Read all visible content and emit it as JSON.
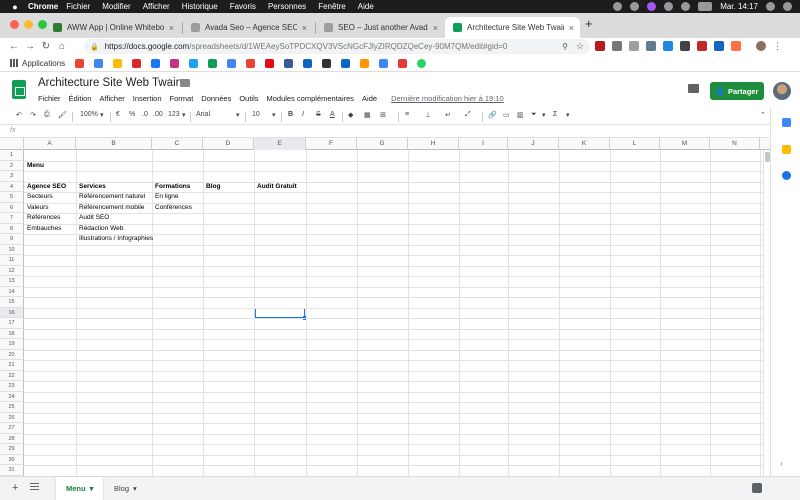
{
  "menubar": {
    "app": "Chrome",
    "items": [
      "Fichier",
      "Modifier",
      "Afficher",
      "Historique",
      "Favoris",
      "Personnes",
      "Fenêtre",
      "Aide"
    ],
    "clock": "Mar. 14:17"
  },
  "tabs": [
    {
      "title": "AWW App | Online Whiteboard",
      "color": "#2e7d32",
      "active": false
    },
    {
      "title": "Avada Seo – Agence SEO",
      "color": "#9e9e9e",
      "active": false
    },
    {
      "title": "SEO – Just another Avada Live",
      "color": "#9e9e9e",
      "active": false
    },
    {
      "title": "Architecture Site Web Twaino",
      "color": "#0f9d58",
      "active": true
    }
  ],
  "address": {
    "host": "https://docs.google.com",
    "path": "/spreadsheets/d/1WEAeySoTPDCXQV3VScNGcFJlyZIRQDZQeCey-90M7QM/edit#gid=0"
  },
  "bookmarks": {
    "apps_label": "Applications",
    "colors": [
      "#ea4335",
      "#4285f4",
      "#fbbc05",
      "#dc2626",
      "#1877f2",
      "#c13584",
      "#1da1f2",
      "#0f9d58",
      "#4285f4",
      "#ea4335",
      "#e50914",
      "#3b5998",
      "#0a66c2",
      "#333333",
      "#0a66c2",
      "#ff9800",
      "#4285f4",
      "#e53935",
      "#25d366"
    ]
  },
  "doc": {
    "title": "Architecture Site Web Twaino",
    "menu": [
      "Fichier",
      "Édition",
      "Afficher",
      "Insertion",
      "Format",
      "Données",
      "Outils",
      "Modules complémentaires",
      "Aide"
    ],
    "last_modified": "Dernière modification hier à 19:10",
    "share_label": "Partager"
  },
  "toolbar": {
    "zoom": "100%",
    "currency": "€",
    "percent": "%",
    "dec_less": ".0",
    "dec_more": ".00",
    "number_format": "123",
    "font": "Arial",
    "font_size": "10",
    "bold": "B",
    "italic": "I",
    "strike": "S",
    "text_color": "A"
  },
  "formula_bar": {
    "fx": "fx",
    "value": ""
  },
  "grid": {
    "columns": [
      "A",
      "B",
      "C",
      "D",
      "E",
      "F",
      "G",
      "H",
      "I",
      "J",
      "K",
      "L",
      "M",
      "N"
    ],
    "rows": [
      "1",
      "2",
      "3",
      "4",
      "5",
      "6",
      "7",
      "8",
      "9",
      "10",
      "11",
      "12",
      "13",
      "14",
      "15",
      "16",
      "17",
      "18",
      "19",
      "20",
      "21",
      "22",
      "23",
      "24",
      "25",
      "26",
      "27",
      "28",
      "29",
      "30",
      "31"
    ],
    "selected_column": "E",
    "selected_row": "16",
    "cells": {
      "A2": "Menu",
      "A4": "Agence SEO",
      "B4": "Services",
      "C4": "Formations",
      "D4": "Blog",
      "E4": "Audit Gratuit",
      "A5": "Secteurs",
      "B5": "Référencement naturel",
      "C5": "En ligne",
      "A6": "Valeurs",
      "B6": "Référencement mobile",
      "C6": "Conférences",
      "A7": "Références",
      "B7": "Audit SEO",
      "A8": "Embauches",
      "B8": "Rédaction Web",
      "B9": "Illustrations / Infographies"
    }
  },
  "sheet_tabs": [
    {
      "name": "Menu",
      "active": true
    },
    {
      "name": "Blog",
      "active": false
    }
  ]
}
